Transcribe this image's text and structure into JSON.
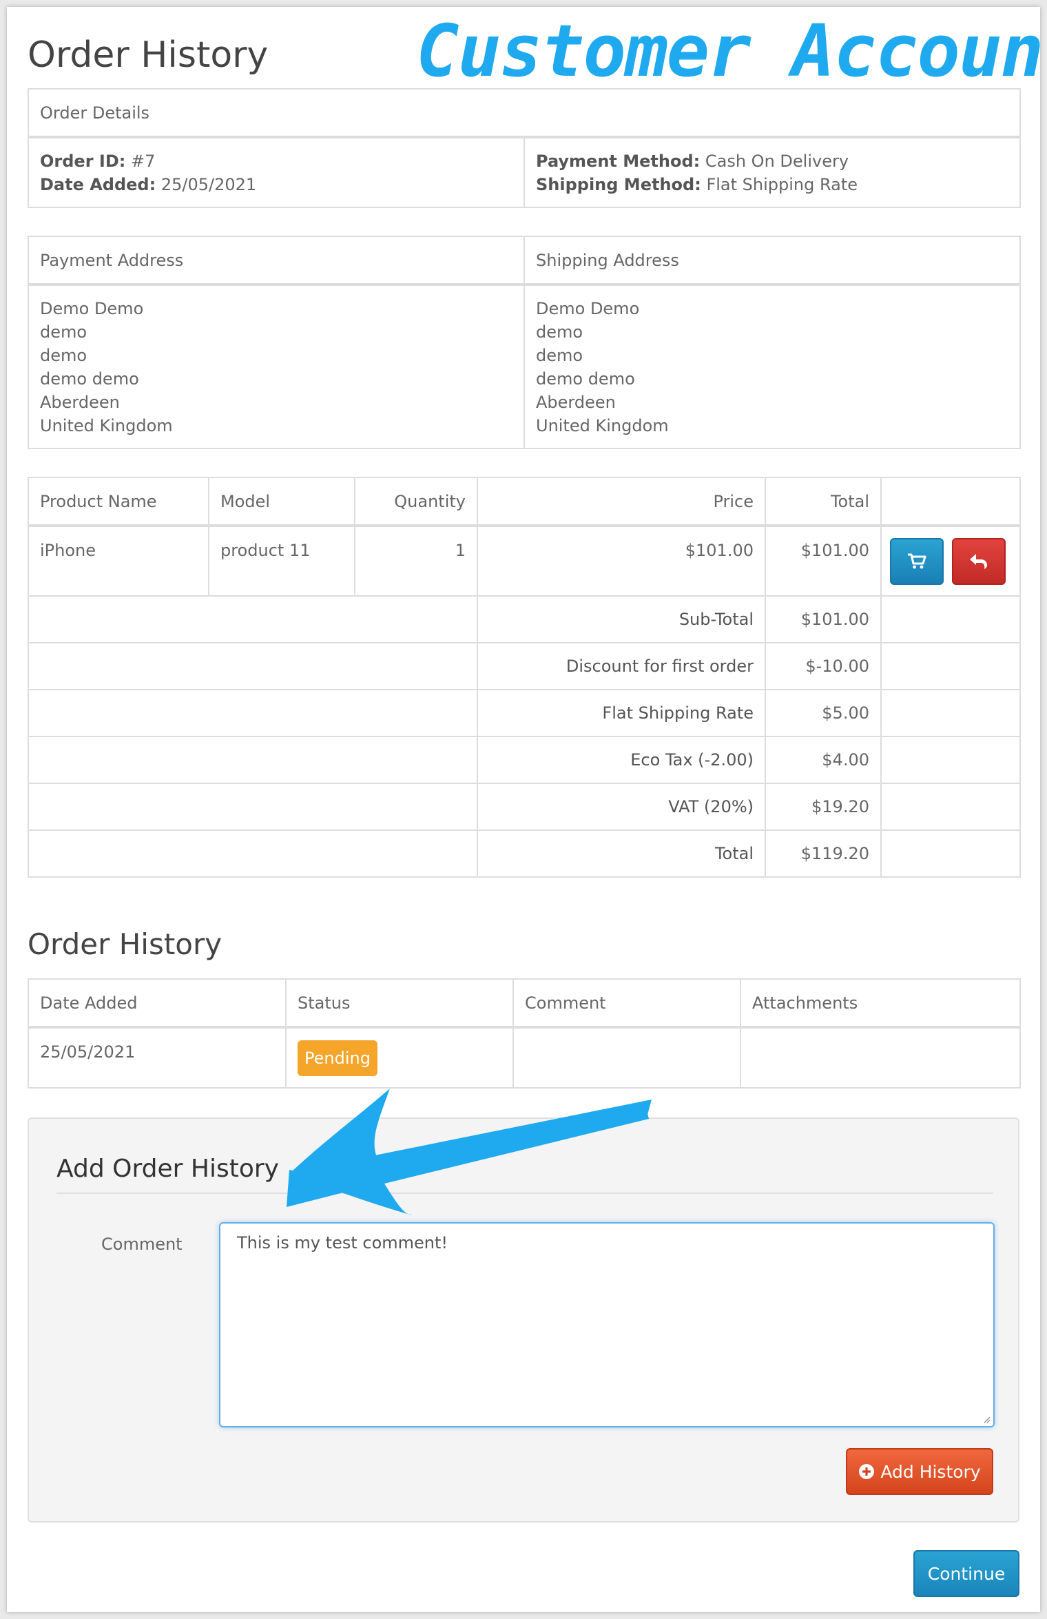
{
  "annotation": "Customer Account",
  "page_title": "Order History",
  "order_details": {
    "heading": "Order Details",
    "order_id_label": "Order ID:",
    "order_id": "#7",
    "date_added_label": "Date Added:",
    "date_added": "25/05/2021",
    "payment_method_label": "Payment Method:",
    "payment_method": "Cash On Delivery",
    "shipping_method_label": "Shipping Method:",
    "shipping_method": "Flat Shipping Rate"
  },
  "addresses": {
    "payment_heading": "Payment Address",
    "shipping_heading": "Shipping Address",
    "payment_lines": [
      "Demo Demo",
      "demo",
      "demo",
      "demo demo",
      "Aberdeen",
      "United Kingdom"
    ],
    "shipping_lines": [
      "Demo Demo",
      "demo",
      "demo",
      "demo demo",
      "Aberdeen",
      "United Kingdom"
    ]
  },
  "products": {
    "headers": {
      "name": "Product Name",
      "model": "Model",
      "quantity": "Quantity",
      "price": "Price",
      "total": "Total"
    },
    "rows": [
      {
        "name": "iPhone",
        "model": "product 11",
        "quantity": "1",
        "price": "$101.00",
        "total": "$101.00"
      }
    ],
    "totals": [
      {
        "label": "Sub-Total",
        "value": "$101.00"
      },
      {
        "label": "Discount for first order",
        "value": "$-10.00"
      },
      {
        "label": "Flat Shipping Rate",
        "value": "$5.00"
      },
      {
        "label": "Eco Tax (-2.00)",
        "value": "$4.00"
      },
      {
        "label": "VAT (20%)",
        "value": "$19.20"
      },
      {
        "label": "Total",
        "value": "$119.20"
      }
    ]
  },
  "history": {
    "heading": "Order History",
    "headers": {
      "date": "Date Added",
      "status": "Status",
      "comment": "Comment",
      "attachments": "Attachments"
    },
    "rows": [
      {
        "date": "25/05/2021",
        "status": "Pending",
        "comment": "",
        "attachments": ""
      }
    ]
  },
  "add_history": {
    "legend": "Add Order History",
    "comment_label": "Comment",
    "comment_value": "This is my test comment!",
    "button_label": "Add History"
  },
  "continue_label": "Continue",
  "colors": {
    "annotation": "#1fa9ee",
    "pending_badge": "#f5a52a",
    "add_button": "#e2532b",
    "primary_button": "#1e8fc6",
    "danger_button": "#d2322d"
  }
}
